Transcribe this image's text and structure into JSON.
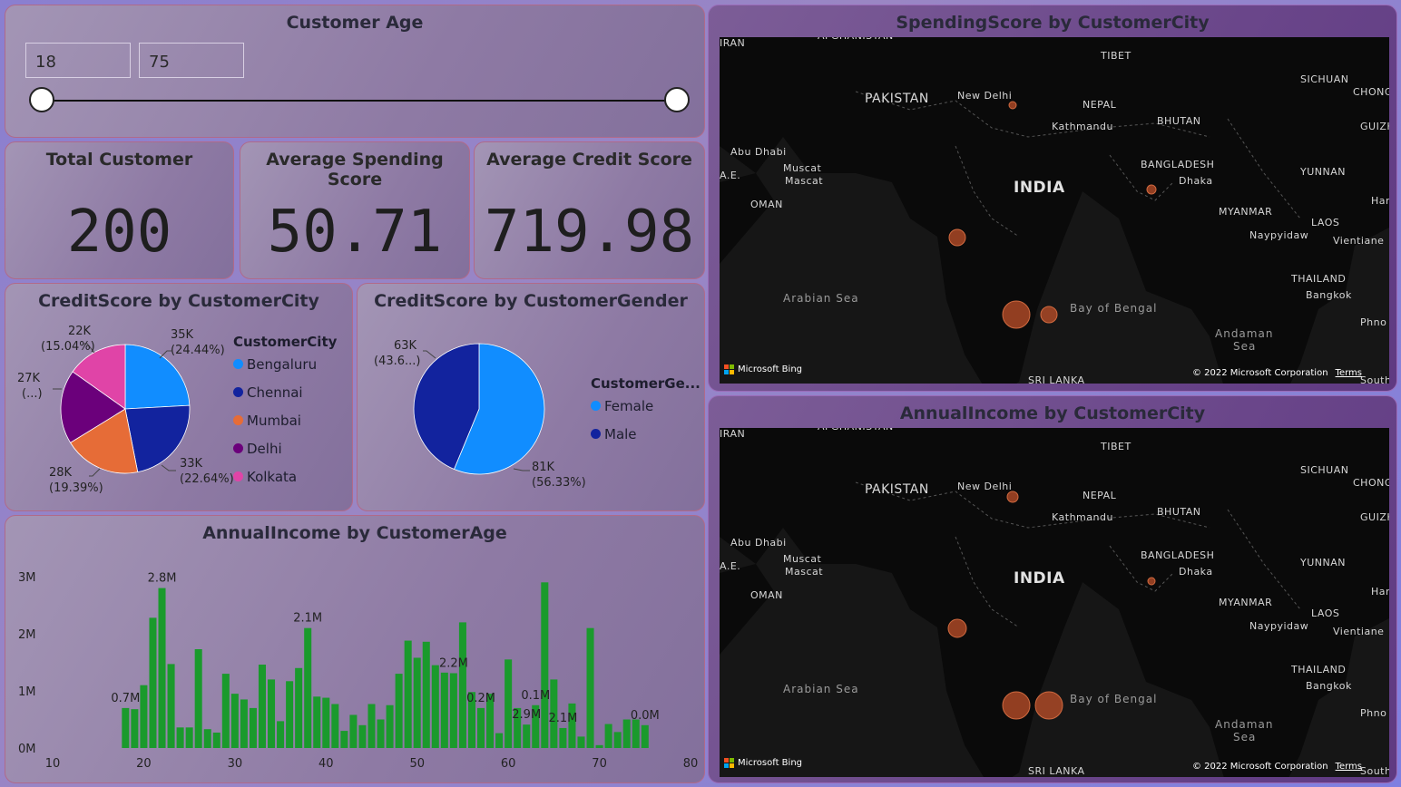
{
  "age_slicer": {
    "title": "Customer Age",
    "min_value": "18",
    "max_value": "75",
    "range_min": 18,
    "range_max": 75
  },
  "kpis": [
    {
      "title": "Total Customer",
      "value": "200"
    },
    {
      "title": "Average Spending Score",
      "value": "50.71"
    },
    {
      "title": "Average Credit Score",
      "value": "719.98"
    }
  ],
  "credit_city": {
    "title": "CreditScore by CustomerCity",
    "legend_title": "CustomerCity",
    "labels": [
      {
        "value": "35K",
        "pct": "(24.44%)"
      },
      {
        "value": "33K",
        "pct": "(22.64%)"
      },
      {
        "value": "28K",
        "pct": "(19.39%)"
      },
      {
        "value": "27K",
        "pct": "(...)"
      },
      {
        "value": "22K",
        "pct": "(15.04%)"
      }
    ]
  },
  "credit_gender": {
    "title": "CreditScore by CustomerGender",
    "legend_title": "CustomerGe...",
    "labels": [
      {
        "value": "81K",
        "pct": "(56.33%)"
      },
      {
        "value": "63K",
        "pct": "(43.6...)"
      }
    ]
  },
  "income_age": {
    "title": "AnnualIncome by CustomerAge"
  },
  "map_spending": {
    "title": "SpendingScore by CustomerCity"
  },
  "map_income": {
    "title": "AnnualIncome by CustomerCity"
  },
  "map_common": {
    "labels": {
      "iran": "IRAN",
      "afghanistan": "AFGHANISTAN",
      "tibet": "TIBET",
      "pakistan": "PAKISTAN",
      "new_delhi": "New Delhi",
      "nepal": "NEPAL",
      "kathmandu": "Kathmandu",
      "bhutan": "BHUTAN",
      "sichuan": "SICHUAN",
      "chong": "CHONG",
      "guiz": "GUIZH",
      "abu_dhabi": "Abu Dhabi",
      "muscat": "Muscat",
      "muscat2": "Mascat",
      "uae": "A.E.",
      "bangladesh": "BANGLADESH",
      "dhaka": "Dhaka",
      "yunnan": "YUNNAN",
      "india": "INDIA",
      "oman": "OMAN",
      "myanmar": "MYANMAR",
      "laos": "LAOS",
      "har": "Har",
      "naypyidaw": "Naypyidaw",
      "vientiane": "Vientiane",
      "thailand": "THAILAND",
      "bangkok": "Bangkok",
      "arabian_sea": "Arabian Sea",
      "bay_of_bengal": "Bay of Bengal",
      "phno": "Phno",
      "andaman": "Andaman",
      "sea": "Sea",
      "sri_lanka": "SRI LANKA",
      "south": "South"
    },
    "bing": "Microsoft Bing",
    "copyright": "© 2022 Microsoft Corporation",
    "terms": "Terms"
  },
  "chart_data": [
    {
      "type": "pie",
      "title": "CreditScore by CustomerCity",
      "legend_title": "CustomerCity",
      "categories": [
        "Bengaluru",
        "Chennai",
        "Mumbai",
        "Delhi",
        "Kolkata"
      ],
      "values": [
        35,
        33,
        28,
        27,
        22
      ],
      "percent": [
        24.44,
        22.64,
        19.39,
        18.49,
        15.04
      ],
      "colors": [
        "#118dff",
        "#12239e",
        "#e66c37",
        "#6b007b",
        "#e044a7"
      ],
      "legend_placement": "right"
    },
    {
      "type": "pie",
      "title": "CreditScore by CustomerGender",
      "legend_title": "CustomerGe...",
      "categories": [
        "Female",
        "Male"
      ],
      "values": [
        81,
        63
      ],
      "percent": [
        56.33,
        43.67
      ],
      "colors": [
        "#118dff",
        "#12239e"
      ],
      "legend_placement": "right"
    },
    {
      "type": "bar",
      "title": "AnnualIncome by CustomerAge",
      "color": "#1a9a2c",
      "xlim": [
        10,
        80
      ],
      "ylim": [
        0,
        3
      ],
      "x_ticks": [
        "10",
        "20",
        "30",
        "40",
        "50",
        "60",
        "70",
        "80"
      ],
      "y_ticks": [
        "0M",
        "1M",
        "2M",
        "3M"
      ],
      "x": [
        18,
        19,
        20,
        21,
        22,
        23,
        24,
        25,
        26,
        27,
        28,
        29,
        30,
        31,
        32,
        33,
        34,
        35,
        36,
        37,
        38,
        39,
        40,
        41,
        42,
        43,
        44,
        45,
        46,
        47,
        48,
        49,
        50,
        51,
        52,
        53,
        54,
        55,
        56,
        57,
        58,
        59,
        60,
        61,
        62,
        63,
        64,
        65,
        66,
        67,
        68,
        69,
        70,
        71,
        72,
        73,
        74,
        75
      ],
      "values": [
        0.7,
        0.68,
        1.1,
        2.28,
        2.8,
        1.47,
        0.36,
        0.36,
        1.73,
        0.33,
        0.27,
        1.3,
        0.95,
        0.85,
        0.7,
        1.46,
        1.2,
        0.47,
        1.17,
        1.4,
        2.1,
        0.9,
        0.88,
        0.77,
        0.3,
        0.58,
        0.4,
        0.77,
        0.5,
        0.75,
        1.3,
        1.88,
        1.58,
        1.86,
        1.45,
        1.32,
        1.31,
        2.2,
        0.98,
        0.7,
        0.95,
        0.26,
        1.55,
        0.7,
        0.41,
        0.75,
        2.9,
        1.2,
        0.35,
        0.78,
        0.2,
        2.1,
        0.05,
        0.42,
        0.28,
        0.5,
        0.5,
        0.4,
        0.7,
        1.3,
        0.05
      ],
      "data_labels": [
        {
          "x": 18,
          "text": "0.7M"
        },
        {
          "x": 22,
          "text": "2.8M"
        },
        {
          "x": 38,
          "text": "2.1M"
        },
        {
          "x": 54,
          "text": "2.2M"
        },
        {
          "x": 57,
          "text": "0.2M"
        },
        {
          "x": 62,
          "text": "2.9M"
        },
        {
          "x": 63,
          "text": "0.1M"
        },
        {
          "x": 66,
          "text": "2.1M"
        },
        {
          "x": 75,
          "text": "0.0M"
        }
      ]
    },
    {
      "type": "scatter",
      "title": "SpendingScore by CustomerCity",
      "categories": [
        "Delhi",
        "Kolkata",
        "Mumbai",
        "Bengaluru",
        "Chennai"
      ],
      "color": "#c0502a"
    },
    {
      "type": "scatter",
      "title": "AnnualIncome by CustomerCity",
      "categories": [
        "Delhi",
        "Kolkata",
        "Mumbai",
        "Bengaluru",
        "Chennai"
      ],
      "color": "#c0502a"
    }
  ]
}
